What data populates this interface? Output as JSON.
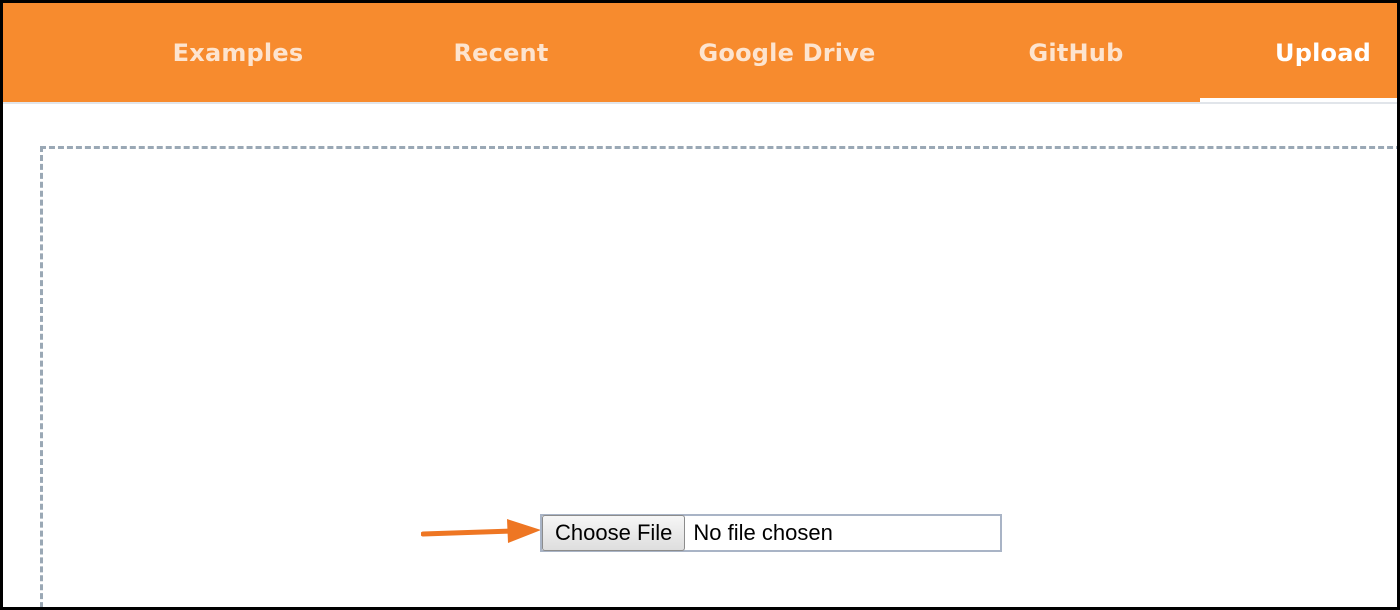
{
  "header": {
    "tabs": [
      {
        "label": "Examples",
        "active": false
      },
      {
        "label": "Recent",
        "active": false
      },
      {
        "label": "Google Drive",
        "active": false
      },
      {
        "label": "GitHub",
        "active": false
      },
      {
        "label": "Upload",
        "active": true
      }
    ],
    "background_color": "#f78b2e"
  },
  "upload": {
    "choose_button_label": "Choose File",
    "file_status": "No file chosen"
  },
  "annotation": {
    "icon": "arrow-right-icon",
    "color": "#ee7623"
  }
}
